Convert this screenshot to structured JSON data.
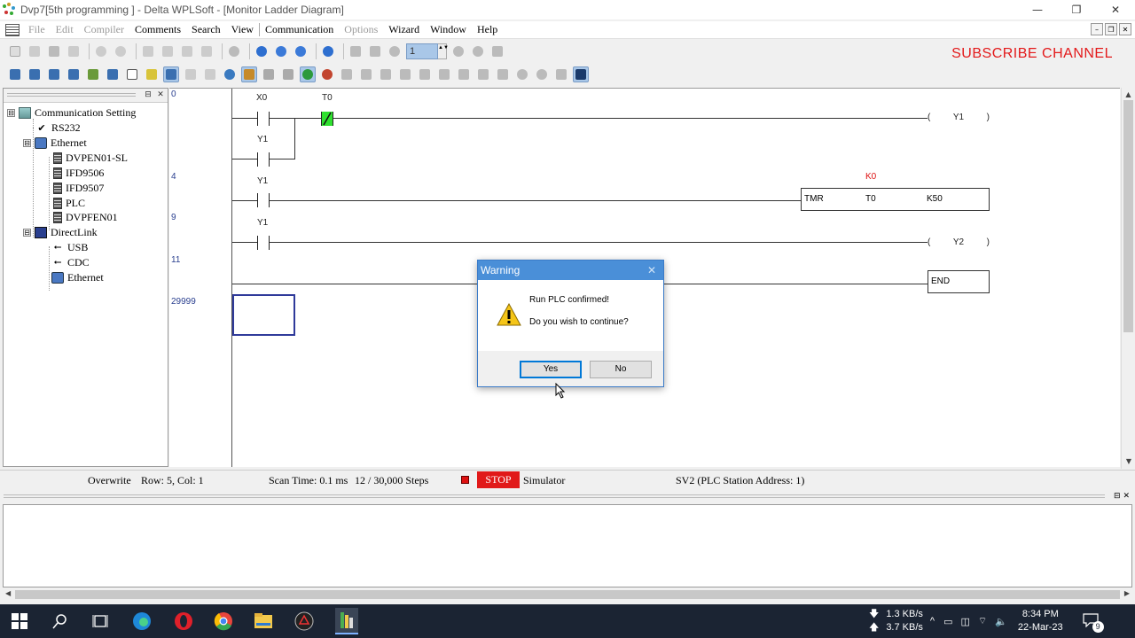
{
  "window": {
    "title": "Dvp7[5th programming ] - Delta WPLSoft - [Monitor Ladder Diagram]",
    "controls": {
      "minimize": "—",
      "restore": "❐",
      "close": "✕"
    }
  },
  "menu": {
    "items": [
      {
        "label": "File",
        "enabled": false
      },
      {
        "label": "Edit",
        "enabled": false
      },
      {
        "label": "Compiler",
        "enabled": false
      },
      {
        "label": "Comments",
        "enabled": true
      },
      {
        "label": "Search",
        "enabled": true
      },
      {
        "label": "View",
        "enabled": true
      },
      {
        "label": "Communication",
        "enabled": true
      },
      {
        "label": "Options",
        "enabled": false
      },
      {
        "label": "Wizard",
        "enabled": true
      },
      {
        "label": "Window",
        "enabled": true
      },
      {
        "label": "Help",
        "enabled": true
      }
    ],
    "mdi": {
      "minimize": "–",
      "restore": "❐",
      "close": "✕"
    }
  },
  "toolbar": {
    "step_value": "1",
    "spin_arrows": "▲▼"
  },
  "overlay_text": "SUBSCRIBE CHANNEL",
  "tree": {
    "nodes": [
      {
        "label": "Communication Setting",
        "icon": "communication-icon",
        "expander": "⊟"
      },
      {
        "label": "RS232",
        "icon": "check-icon",
        "glyph": "✔"
      },
      {
        "label": "Ethernet",
        "icon": "network-icon",
        "expander": "⊟"
      },
      {
        "label": "DVPEN01-SL",
        "icon": "device-icon"
      },
      {
        "label": "IFD9506",
        "icon": "device-icon"
      },
      {
        "label": "IFD9507",
        "icon": "device-icon"
      },
      {
        "label": "PLC",
        "icon": "device-icon"
      },
      {
        "label": "DVPFEN01",
        "icon": "device-icon"
      },
      {
        "label": "DirectLink",
        "icon": "directlink-icon",
        "expander": "⊟"
      },
      {
        "label": "USB",
        "icon": "usb-icon",
        "glyph": "⭠"
      },
      {
        "label": "CDC",
        "icon": "usb-icon",
        "glyph": "⭠"
      },
      {
        "label": "Ethernet",
        "icon": "network-icon"
      }
    ],
    "panel_buttons": {
      "pin": "⊟",
      "close": "✕"
    }
  },
  "ladder": {
    "steps": [
      "0",
      "4",
      "9",
      "11",
      "29999"
    ],
    "contacts": {
      "x0": "X0",
      "t0": "T0",
      "y1_seal": "Y1",
      "y1_timer": "Y1",
      "y1_out": "Y1"
    },
    "coil_y1": {
      "open": "(",
      "name": "Y1",
      "close": ")"
    },
    "coil_y2": {
      "open": "(",
      "name": "Y2",
      "close": ")"
    },
    "timer": {
      "preset_value": "K0",
      "op": "TMR",
      "timer": "T0",
      "preset": "K50"
    },
    "end_label": "END"
  },
  "statusbar": {
    "mode": "Overwrite",
    "position": "Row: 5, Col: 1",
    "scan_time": "Scan Time: 0.1 ms",
    "steps": "12 / 30,000 Steps",
    "run_state": "STOP",
    "simulator": "Simulator",
    "station": "SV2 (PLC Station Address: 1)"
  },
  "output_panel": {
    "pin": "⊟",
    "close": "✕"
  },
  "dialog": {
    "title": "Warning",
    "close": "✕",
    "line1": "Run PLC confirmed!",
    "line2": "Do you wish to continue?",
    "yes": "Yes",
    "no": "No"
  },
  "taskbar": {
    "apps": [
      "windows-start",
      "search",
      "task-view",
      "edge",
      "opera",
      "chrome",
      "file-explorer",
      "delta-app",
      "wplsoft"
    ],
    "net_down": "1.3 KB/s",
    "net_up": "3.7 KB/s",
    "time": "8:34 PM",
    "date": "22-Mar-23",
    "notification_count": "9",
    "tray_glyphs": {
      "down": "🡇",
      "up": "🡅",
      "chevron": "^",
      "wifi": "⌔",
      "volume": "🔈"
    }
  },
  "colors": {
    "accent_blue": "#4a8fd8",
    "stop_red": "#e11919",
    "subscribe_red": "#e3191a",
    "active_contact_green": "#2fe02f",
    "taskbar": "#1b2433"
  }
}
